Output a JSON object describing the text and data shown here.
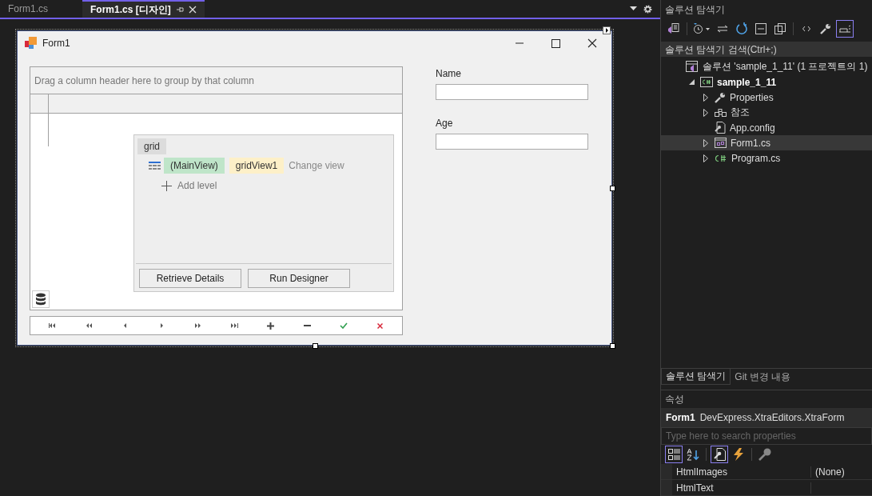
{
  "editor_tabs": [
    {
      "label": "Form1.cs",
      "selected": false
    },
    {
      "label": "Form1.cs [디자인]",
      "selected": true
    }
  ],
  "form": {
    "title": "Form1",
    "grid": {
      "group_panel": "Drag a column header here to group by that column",
      "level_designer": {
        "tab": "grid",
        "main_view": "(MainView)",
        "view_name": "gridView1",
        "change_view": "Change view",
        "add_level": "Add level",
        "buttons": [
          "Retrieve Details",
          "Run Designer"
        ]
      },
      "navigator": [
        {
          "kind": "first"
        },
        {
          "kind": "prev-page"
        },
        {
          "kind": "prev"
        },
        {
          "kind": "next"
        },
        {
          "kind": "next-page"
        },
        {
          "kind": "last"
        },
        {
          "kind": "append"
        },
        {
          "kind": "remove"
        },
        {
          "kind": "end-edit"
        },
        {
          "kind": "cancel-edit"
        }
      ]
    },
    "fields": [
      {
        "label": "Name"
      },
      {
        "label": "Age"
      }
    ]
  },
  "solution_explorer": {
    "title": "솔루션 탐색기",
    "toolbar": [
      {
        "kind": "home",
        "selected": false
      },
      {
        "kind": "history",
        "selected": false
      },
      {
        "kind": "sync",
        "selected": false
      },
      {
        "kind": "refresh",
        "selected": false
      },
      {
        "kind": "collapse",
        "selected": false
      },
      {
        "kind": "copy",
        "selected": false
      },
      {
        "kind": "code",
        "selected": false
      },
      {
        "kind": "wrench",
        "selected": false
      },
      {
        "kind": "preview",
        "selected": true
      }
    ],
    "search": {
      "placeholder": "솔루션 탐색기 검색(Ctrl+;)"
    },
    "tree": [
      {
        "kind": "solution",
        "label": "솔루션 'sample_1_11'  (1 프로젝트의 1)",
        "selected": false,
        "children": [
          {
            "kind": "project",
            "label": "sample_1_11",
            "expandable": true,
            "expanded": true,
            "selected": false,
            "children": [
              {
                "kind": "properties",
                "label": "Properties",
                "expandable": true,
                "expanded": false,
                "selected": false
              },
              {
                "kind": "references",
                "label": "참조",
                "expandable": true,
                "expanded": false,
                "selected": false
              },
              {
                "kind": "config",
                "label": "App.config",
                "expandable": false,
                "selected": false
              },
              {
                "kind": "form",
                "label": "Form1.cs",
                "expandable": true,
                "expanded": false,
                "selected": true
              },
              {
                "kind": "csharp",
                "label": "Program.cs",
                "expandable": true,
                "expanded": false,
                "selected": false
              }
            ]
          }
        ]
      }
    ],
    "bottom_tabs": [
      {
        "label": "솔루션 탐색기",
        "selected": true
      },
      {
        "label": "Git 변경 내용",
        "selected": false
      }
    ]
  },
  "properties": {
    "title": "속성",
    "object_name": "Form1",
    "object_type": "DevExpress.XtraEditors.XtraForm",
    "search": {
      "placeholder": "Type here to search properties"
    },
    "toolbar": [
      {
        "kind": "categorized",
        "selected": true
      },
      {
        "kind": "alphabetical",
        "selected": false
      },
      {
        "kind": "properties",
        "selected": true
      },
      {
        "kind": "events",
        "selected": false
      },
      {
        "kind": "pages",
        "selected": false
      }
    ],
    "rows": [
      {
        "name": "HtmlImages",
        "value": "(None)"
      },
      {
        "name": "HtmlText"
      }
    ]
  }
}
